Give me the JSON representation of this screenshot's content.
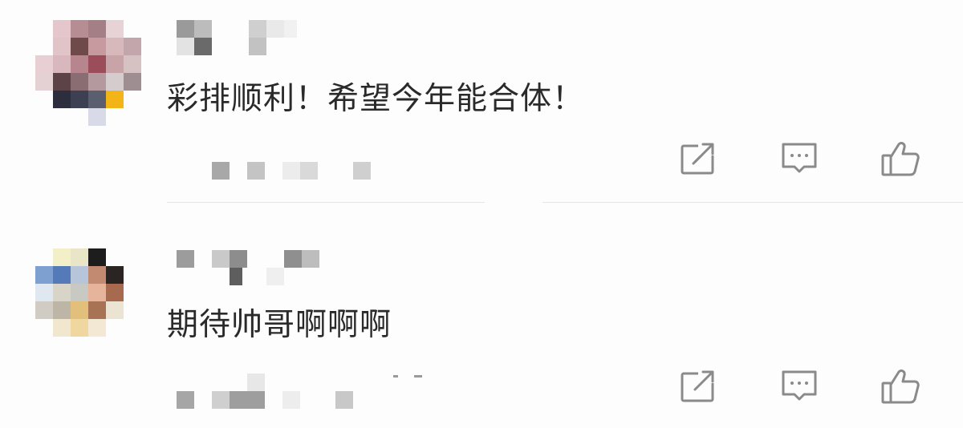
{
  "comments": [
    {
      "text": "彩排顺利！希望今年能合体！",
      "avatar_icon": "user-avatar-pixelated",
      "actions": [
        {
          "icon": "share-icon",
          "name": "share"
        },
        {
          "icon": "comment-icon",
          "name": "reply"
        },
        {
          "icon": "thumbs-up-icon",
          "name": "like"
        }
      ]
    },
    {
      "text": "期待帅哥啊啊啊",
      "avatar_icon": "user-avatar-pixelated",
      "actions": [
        {
          "icon": "share-icon",
          "name": "share"
        },
        {
          "icon": "comment-icon",
          "name": "reply"
        },
        {
          "icon": "thumbs-up-icon",
          "name": "like"
        }
      ]
    }
  ],
  "colors": {
    "text": "#2a2a2a",
    "icon": "#8a8a8a",
    "divider": "#e6e6e6",
    "mosaic_dark": "#6d6d6d",
    "mosaic_light": "#d6d6d6"
  }
}
